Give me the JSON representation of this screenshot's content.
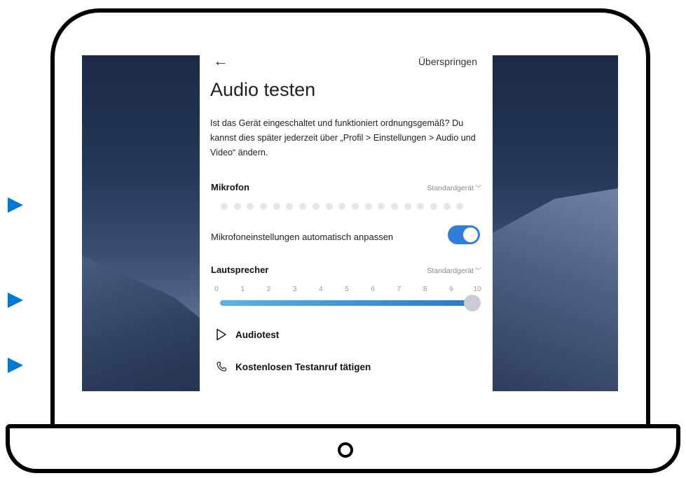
{
  "nav": {
    "back_icon": "back-arrow-icon",
    "skip_label": "Überspringen"
  },
  "content": {
    "title": "Audio testen",
    "description": "Ist das Gerät eingeschaltet und funktioniert ordnungsgemäß? Du kannst dies später jederzeit über „Profil > Einstellungen > Audio und Video“ ändern."
  },
  "microphone": {
    "label": "Mikrofon",
    "device": "Standardgerät",
    "level_active_dots": 0,
    "dots_total": 19,
    "auto_adjust_label": "Mikrofoneinstellungen automatisch anpassen",
    "auto_adjust_on": true
  },
  "speaker": {
    "label": "Lautsprecher",
    "device": "Standardgerät",
    "ticks": [
      "0",
      "1",
      "2",
      "3",
      "4",
      "5",
      "6",
      "7",
      "8",
      "9",
      "10"
    ],
    "volume": 10
  },
  "actions": {
    "audiotest_label": "Audiotest",
    "testcall_label": "Kostenlosen Testanruf tätigen"
  },
  "colors": {
    "accent": "#2f7fd6",
    "marker": "#0078d4"
  }
}
